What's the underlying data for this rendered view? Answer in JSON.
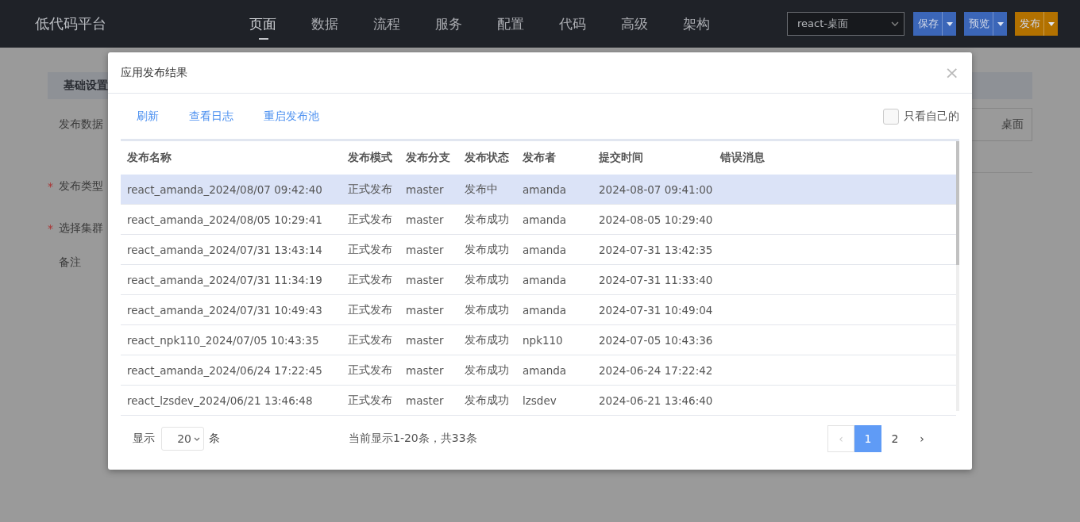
{
  "app_title": "低代码平台",
  "nav": [
    {
      "label": "页面",
      "selected": true
    },
    {
      "label": "数据",
      "selected": false
    },
    {
      "label": "流程",
      "selected": false
    },
    {
      "label": "服务",
      "selected": false
    },
    {
      "label": "配置",
      "selected": false
    },
    {
      "label": "代码",
      "selected": false
    },
    {
      "label": "高级",
      "selected": false
    },
    {
      "label": "架构",
      "selected": false
    }
  ],
  "app_select": {
    "value": "react-桌面"
  },
  "header_buttons": [
    {
      "label": "保存",
      "kind": "primary"
    },
    {
      "label": "预览",
      "kind": "primary"
    },
    {
      "label": "发布",
      "kind": "warning"
    }
  ],
  "background_form": {
    "section_title": "基础设置",
    "required_mark": "*",
    "fields": [
      {
        "label": "发布数据",
        "required": false
      },
      {
        "label": "发布类型",
        "required": true
      },
      {
        "label": "选择集群",
        "required": true
      },
      {
        "label": "备注",
        "required": false
      }
    ],
    "button": "桌面"
  },
  "dialog": {
    "title": "应用发布结果",
    "close": "×",
    "actions": [
      "刷新",
      "查看日志",
      "重启发布池"
    ],
    "only_mine": {
      "label": "只看自己的",
      "checked": false
    },
    "table": {
      "columns": [
        "发布名称",
        "发布模式",
        "发布分支",
        "发布状态",
        "发布者",
        "提交时间",
        "错误消息"
      ],
      "rows": [
        {
          "cells": [
            "react_amanda_2024/08/07 09:42:40",
            "正式发布",
            "master",
            "发布中",
            "amanda",
            "2024-08-07 09:41:00",
            ""
          ],
          "selected": true
        },
        {
          "cells": [
            "react_amanda_2024/08/05 10:29:41",
            "正式发布",
            "master",
            "发布成功",
            "amanda",
            "2024-08-05 10:29:40",
            ""
          ],
          "selected": false
        },
        {
          "cells": [
            "react_amanda_2024/07/31 13:43:14",
            "正式发布",
            "master",
            "发布成功",
            "amanda",
            "2024-07-31 13:42:35",
            ""
          ],
          "selected": false
        },
        {
          "cells": [
            "react_amanda_2024/07/31 11:34:19",
            "正式发布",
            "master",
            "发布成功",
            "amanda",
            "2024-07-31 11:33:40",
            ""
          ],
          "selected": false
        },
        {
          "cells": [
            "react_amanda_2024/07/31 10:49:43",
            "正式发布",
            "master",
            "发布成功",
            "amanda",
            "2024-07-31 10:49:04",
            ""
          ],
          "selected": false
        },
        {
          "cells": [
            "react_npk110_2024/07/05 10:43:35",
            "正式发布",
            "master",
            "发布成功",
            "npk110",
            "2024-07-05 10:43:36",
            ""
          ],
          "selected": false
        },
        {
          "cells": [
            "react_amanda_2024/06/24 17:22:45",
            "正式发布",
            "master",
            "发布成功",
            "amanda",
            "2024-06-24 17:22:42",
            ""
          ],
          "selected": false
        },
        {
          "cells": [
            "react_lzsdev_2024/06/21 13:46:48",
            "正式发布",
            "master",
            "发布成功",
            "lzsdev",
            "2024-06-21 13:46:40",
            ""
          ],
          "selected": false
        }
      ]
    },
    "footer": {
      "show_label": "显示",
      "page_size": "20",
      "unit": "条",
      "summary": "当前显示1-20条，共33条",
      "pages": [
        {
          "label": "‹",
          "kind": "prev",
          "disabled": true,
          "selected": false
        },
        {
          "label": "1",
          "kind": "page",
          "disabled": false,
          "selected": true
        },
        {
          "label": "2",
          "kind": "page",
          "disabled": false,
          "selected": false
        },
        {
          "label": "›",
          "kind": "next",
          "disabled": false,
          "selected": false
        }
      ]
    }
  }
}
